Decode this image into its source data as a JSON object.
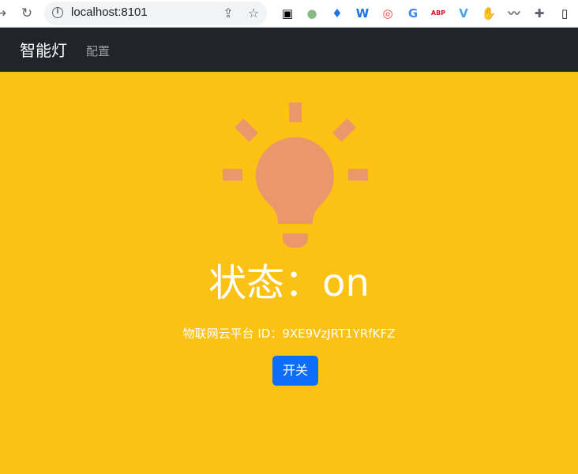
{
  "browser": {
    "url": "localhost:8101",
    "info_glyph": "i",
    "back_glyph": "→",
    "reload_glyph": "↻",
    "share_glyph": "⇪",
    "star_glyph": "☆",
    "extensions": [
      {
        "name": "qr-extension-icon",
        "color": "#000000",
        "glyph": "▣"
      },
      {
        "name": "green-dot-extension-icon",
        "color": "#8ab887",
        "glyph": "●"
      },
      {
        "name": "diamond-extension-icon",
        "color": "#1a73e8",
        "glyph": "♦"
      },
      {
        "name": "w-extension-icon",
        "color": "#1a73e8",
        "glyph": "W"
      },
      {
        "name": "chrome-extension-icon",
        "color": "#e8453c",
        "glyph": "◎"
      },
      {
        "name": "translate-extension-icon",
        "color": "#4285f4",
        "glyph": "G"
      },
      {
        "name": "abp-extension-icon",
        "color": "#e0102a",
        "glyph": "ABP"
      },
      {
        "name": "v-extension-icon",
        "color": "#42a5f5",
        "glyph": "V"
      },
      {
        "name": "hand-extension-icon",
        "color": "#5f6368",
        "glyph": "✋"
      },
      {
        "name": "squiggle-extension-icon",
        "color": "#5f6368",
        "glyph": "〰"
      },
      {
        "name": "puzzle-extension-icon",
        "color": "#5f6368",
        "glyph": "✚"
      },
      {
        "name": "sidepanel-icon",
        "color": "#202124",
        "glyph": "▯"
      }
    ]
  },
  "navbar": {
    "brand": "智能灯",
    "link": "配置"
  },
  "main": {
    "status": "状态：on",
    "platform_id": "物联网云平台 ID：9XE9VzJRT1YRfKFZ",
    "toggle_label": "开关",
    "bulb_color": "#ea976b",
    "background_color": "#fbc115"
  }
}
